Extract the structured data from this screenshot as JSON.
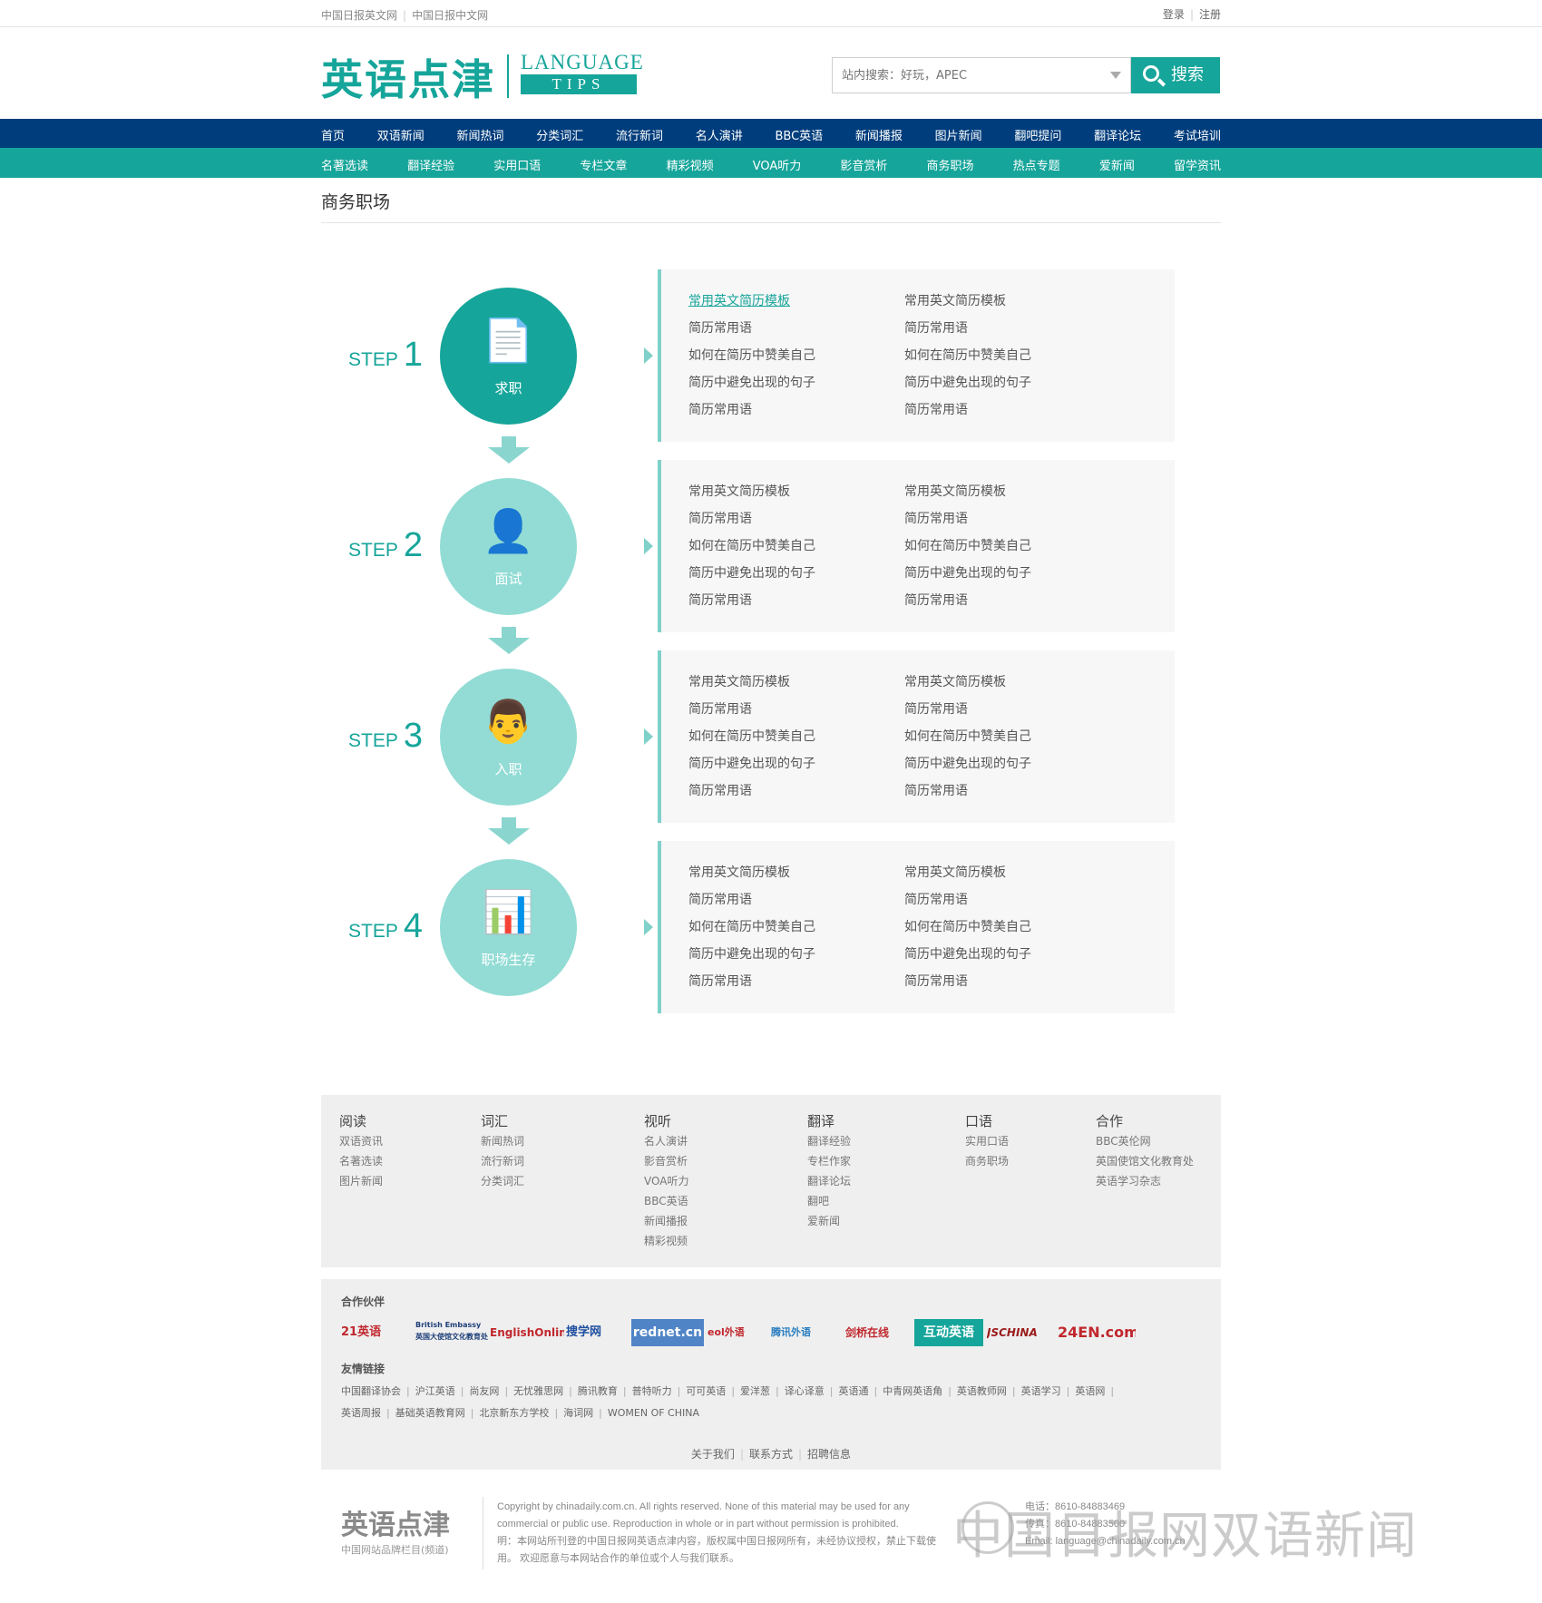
{
  "topbar": {
    "left_links": [
      "中国日报英文网",
      "中国日报中文网"
    ],
    "login": "登录",
    "register": "注册"
  },
  "logo": {
    "cn": "英语点津",
    "en_top": "LANGUAGE",
    "en_bottom": "TIPS"
  },
  "search": {
    "placeholder": "站内搜索：好玩，APEC",
    "button": "搜索"
  },
  "nav_primary": [
    "首页",
    "双语新闻",
    "新闻热词",
    "分类词汇",
    "流行新词",
    "名人演讲",
    "BBC英语",
    "新闻播报",
    "图片新闻",
    "翻吧提问",
    "翻译论坛",
    "考试培训"
  ],
  "nav_secondary": [
    "名著选读",
    "翻译经验",
    "实用口语",
    "专栏文章",
    "精彩视频",
    "VOA听力",
    "影音赏析",
    "商务职场",
    "热点专题",
    "爱新闻",
    "留学资讯"
  ],
  "page_title": "商务职场",
  "steps": [
    {
      "word": "STEP",
      "num": "1",
      "label": "求职",
      "icon": "resume-icon",
      "col1": [
        "常用英文简历模板",
        "简历常用语",
        "如何在简历中赞美自己",
        "简历中避免出现的句子",
        "简历常用语"
      ],
      "col2": [
        "常用英文简历模板",
        "简历常用语",
        "如何在简历中赞美自己",
        "简历中避免出现的句子",
        "简历常用语"
      ]
    },
    {
      "word": "STEP",
      "num": "2",
      "label": "面试",
      "icon": "interview-icon",
      "col1": [
        "常用英文简历模板",
        "简历常用语",
        "如何在简历中赞美自己",
        "简历中避免出现的句子",
        "简历常用语"
      ],
      "col2": [
        "常用英文简历模板",
        "简历常用语",
        "如何在简历中赞美自己",
        "简历中避免出现的句子",
        "简历常用语"
      ]
    },
    {
      "word": "STEP",
      "num": "3",
      "label": "入职",
      "icon": "employee-icon",
      "col1": [
        "常用英文简历模板",
        "简历常用语",
        "如何在简历中赞美自己",
        "简历中避免出现的句子",
        "简历常用语"
      ],
      "col2": [
        "常用英文简历模板",
        "简历常用语",
        "如何在简历中赞美自己",
        "简历中避免出现的句子",
        "简历常用语"
      ]
    },
    {
      "word": "STEP",
      "num": "4",
      "label": "职场生存",
      "icon": "presentation-icon",
      "col1": [
        "常用英文简历模板",
        "简历常用语",
        "如何在简历中赞美自己",
        "简历中避免出现的句子",
        "简历常用语"
      ],
      "col2": [
        "常用英文简历模板",
        "简历常用语",
        "如何在简历中赞美自己",
        "简历中避免出现的句子",
        "简历常用语"
      ]
    }
  ],
  "footer_nav": [
    {
      "title": "阅读",
      "items": [
        "双语资讯",
        "名著选读",
        "图片新闻"
      ]
    },
    {
      "title": "词汇",
      "items": [
        "新闻热词",
        "流行新词",
        "分类词汇"
      ]
    },
    {
      "title": "视听",
      "items": [
        "名人演讲",
        "影音赏析",
        "VOA听力",
        "BBC英语",
        "新闻播报",
        "精彩视频"
      ]
    },
    {
      "title": "翻译",
      "items": [
        "翻译经验",
        "专栏作家",
        "翻译论坛",
        "翻吧",
        "爱新闻"
      ]
    },
    {
      "title": "口语",
      "items": [
        "实用口语",
        "商务职场"
      ]
    },
    {
      "title": "合作",
      "items": [
        "BBC英伦网",
        "英国使馆文化教育处",
        "英语学习杂志"
      ]
    }
  ],
  "partners": {
    "title": "合作伙伴",
    "logos": [
      "21英语",
      "British Embassy 英国大使馆文化教育处",
      "EnglishOnline",
      "搜学网",
      "rednet.cn",
      "eol外语",
      "腾讯外语",
      "剑桥在线",
      "互动英语",
      "JSCHINA",
      "24EN.com"
    ],
    "friends_title": "友情链接",
    "friends_row1": [
      "中国翻译协会",
      "沪江英语",
      "尚友网",
      "无忧雅思网",
      "腾讯教育",
      "普特听力",
      "可可英语",
      "爱洋葱",
      "译心译意",
      "英语通",
      "中青网英语角",
      "英语教师网",
      "英语学习",
      "英语网"
    ],
    "friends_row2": [
      "英语周报",
      "基础英语教育网",
      "北京新东方学校",
      "海词网",
      "WOMEN OF CHINA"
    ],
    "about": [
      "关于我们",
      "联系方式",
      "招聘信息"
    ]
  },
  "bottom": {
    "logo": "英语点津",
    "logo_sub": "中国网站品牌栏目(频道)",
    "copyright_1": "Copyright by chinadaily.com.cn. All rights reserved. None of this material may be used for any",
    "copyright_2": "commercial or public use. Reproduction in whole or in part without permission is prohibited.",
    "copyright_3": "明：本网站所刊登的中国日报网英语点津内容，版权属中国日报网所有，未经协议授权，禁止下载使",
    "copyright_4": "用。 欢迎愿意与本网站合作的单位或个人与我们联系。",
    "phone": "电话：8610-84883469",
    "fax": "传真：8610-84883500",
    "email": "Email: language@chinadaily.com.cn"
  },
  "watermark": "中国日报网双语新闻",
  "colors": {
    "teal": "#16a59a",
    "navy": "#003d7c",
    "light_teal": "#92dcd5"
  }
}
